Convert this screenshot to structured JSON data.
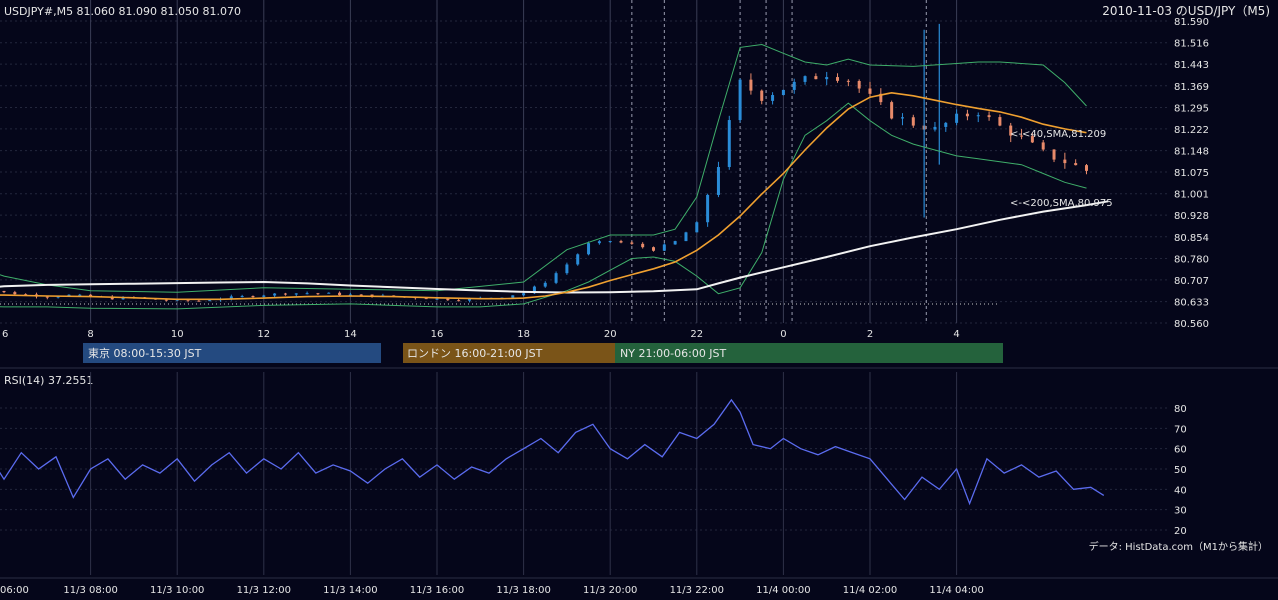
{
  "header": {
    "symbol_info": "USDJPY#,M5 81.060 81.090 81.050 81.070",
    "chart_title": "2010-11-03 のUSD/JPY（M5)"
  },
  "colors": {
    "background": "#05061a",
    "candle_up": "#2a8cd8",
    "candle_down": "#e88a6a",
    "sma40": "#f0a030",
    "sma200": "#f2f2f2",
    "bollinger": "#3fae6a",
    "rsi": "#5b6cf0",
    "tokyo_band": "#244a80",
    "london_band": "#7a5418",
    "ny_band": "#24623c"
  },
  "chart_data": [
    {
      "type": "candlestick",
      "price_ticks": [
        "81.590",
        "81.516",
        "81.443",
        "81.369",
        "81.295",
        "81.222",
        "81.148",
        "81.075",
        "81.001",
        "80.928",
        "80.854",
        "80.780",
        "80.707",
        "80.633",
        "80.560"
      ],
      "ylim": [
        80.56,
        81.59
      ],
      "hour_ticks": [
        "6",
        "8",
        "10",
        "12",
        "14",
        "16",
        "18",
        "20",
        "22",
        "0",
        "2",
        "4"
      ],
      "annotations": [
        {
          "text": "<-<40,SMA,81.209",
          "series": "sma40",
          "value": 81.209
        },
        {
          "text": "<-<200,SMA,80.975",
          "series": "sma200",
          "value": 80.975
        }
      ],
      "sessions": [
        {
          "label": "東京 08:00-15:30 JST",
          "color_key": "tokyo_band"
        },
        {
          "label": "ロンドン 16:00-21:00 JST",
          "color_key": "london_band"
        },
        {
          "label": "NY 21:00-06:00 JST",
          "color_key": "ny_band"
        }
      ],
      "close_series": [
        [
          5.0,
          80.686
        ],
        [
          5.5,
          80.676
        ],
        [
          6.0,
          80.664
        ],
        [
          6.5,
          80.657
        ],
        [
          7.0,
          80.65
        ],
        [
          7.5,
          80.655
        ],
        [
          8.0,
          80.65
        ],
        [
          8.5,
          80.644
        ],
        [
          9.0,
          80.647
        ],
        [
          9.5,
          80.64
        ],
        [
          10.0,
          80.636
        ],
        [
          10.5,
          80.636
        ],
        [
          11.0,
          80.644
        ],
        [
          11.5,
          80.65
        ],
        [
          12.0,
          80.656
        ],
        [
          12.5,
          80.661
        ],
        [
          13.0,
          80.662
        ],
        [
          13.5,
          80.66
        ],
        [
          14.0,
          80.656
        ],
        [
          14.5,
          80.653
        ],
        [
          15.0,
          80.65
        ],
        [
          15.5,
          80.647
        ],
        [
          16.0,
          80.642
        ],
        [
          16.5,
          80.64
        ],
        [
          17.0,
          80.644
        ],
        [
          17.5,
          80.65
        ],
        [
          18.0,
          80.662
        ],
        [
          18.5,
          80.7
        ],
        [
          19.0,
          80.76
        ],
        [
          19.5,
          80.83
        ],
        [
          20.0,
          80.84
        ],
        [
          20.5,
          80.828
        ],
        [
          21.0,
          80.81
        ],
        [
          21.5,
          80.838
        ],
        [
          22.0,
          80.9
        ],
        [
          22.5,
          81.1
        ],
        [
          23.0,
          81.38
        ],
        [
          23.5,
          81.33
        ],
        [
          24.0,
          81.36
        ],
        [
          24.5,
          81.39
        ],
        [
          25.0,
          81.41
        ],
        [
          25.5,
          81.39
        ],
        [
          26.0,
          81.33
        ],
        [
          26.5,
          81.27
        ],
        [
          27.0,
          81.24
        ],
        [
          27.5,
          81.22
        ],
        [
          28.0,
          81.26
        ],
        [
          28.5,
          81.28
        ],
        [
          29.0,
          81.23
        ],
        [
          29.5,
          81.19
        ],
        [
          30.0,
          81.14
        ],
        [
          30.5,
          81.11
        ],
        [
          31.0,
          81.08
        ]
      ],
      "sma40": [
        [
          5.0,
          80.655
        ],
        [
          6.0,
          80.655
        ],
        [
          7.0,
          80.652
        ],
        [
          8.0,
          80.65
        ],
        [
          9.0,
          80.646
        ],
        [
          10.0,
          80.641
        ],
        [
          11.0,
          80.641
        ],
        [
          12.0,
          80.645
        ],
        [
          13.0,
          80.65
        ],
        [
          14.0,
          80.652
        ],
        [
          15.0,
          80.65
        ],
        [
          16.0,
          80.646
        ],
        [
          17.0,
          80.643
        ],
        [
          17.5,
          80.643
        ],
        [
          18.0,
          80.645
        ],
        [
          18.5,
          80.652
        ],
        [
          19.0,
          80.665
        ],
        [
          19.5,
          80.682
        ],
        [
          20.0,
          80.705
        ],
        [
          20.5,
          80.725
        ],
        [
          21.0,
          80.745
        ],
        [
          21.5,
          80.768
        ],
        [
          22.0,
          80.808
        ],
        [
          22.5,
          80.86
        ],
        [
          23.0,
          80.925
        ],
        [
          23.5,
          81.0
        ],
        [
          24.0,
          81.07
        ],
        [
          24.5,
          81.15
        ],
        [
          25.0,
          81.225
        ],
        [
          25.5,
          81.29
        ],
        [
          26.0,
          81.33
        ],
        [
          26.5,
          81.345
        ],
        [
          27.0,
          81.335
        ],
        [
          27.5,
          81.32
        ],
        [
          28.0,
          81.305
        ],
        [
          28.5,
          81.292
        ],
        [
          29.0,
          81.28
        ],
        [
          29.5,
          81.262
        ],
        [
          30.0,
          81.238
        ],
        [
          30.5,
          81.222
        ],
        [
          31.0,
          81.209
        ]
      ],
      "sma200": [
        [
          5.0,
          80.675
        ],
        [
          6.0,
          80.685
        ],
        [
          7.0,
          80.69
        ],
        [
          8.0,
          80.692
        ],
        [
          9.0,
          80.694
        ],
        [
          10.0,
          80.696
        ],
        [
          11.0,
          80.698
        ],
        [
          12.0,
          80.7
        ],
        [
          13.0,
          80.695
        ],
        [
          14.0,
          80.688
        ],
        [
          15.0,
          80.682
        ],
        [
          16.0,
          80.676
        ],
        [
          17.0,
          80.671
        ],
        [
          18.0,
          80.666
        ],
        [
          19.0,
          80.664
        ],
        [
          20.0,
          80.665
        ],
        [
          21.0,
          80.668
        ],
        [
          22.0,
          80.675
        ],
        [
          22.5,
          80.695
        ],
        [
          23.0,
          80.715
        ],
        [
          24.0,
          80.75
        ],
        [
          25.0,
          80.785
        ],
        [
          26.0,
          80.822
        ],
        [
          27.0,
          80.852
        ],
        [
          28.0,
          80.88
        ],
        [
          29.0,
          80.912
        ],
        [
          30.0,
          80.94
        ],
        [
          31.0,
          80.962
        ],
        [
          31.5,
          80.975
        ]
      ],
      "bollinger_upper": [
        [
          5.0,
          80.77
        ],
        [
          6.0,
          80.72
        ],
        [
          7.0,
          80.69
        ],
        [
          8.0,
          80.67
        ],
        [
          10.0,
          80.665
        ],
        [
          12.0,
          80.68
        ],
        [
          14.0,
          80.675
        ],
        [
          16.0,
          80.67
        ],
        [
          18.0,
          80.7
        ],
        [
          19.0,
          80.81
        ],
        [
          20.0,
          80.86
        ],
        [
          21.0,
          80.86
        ],
        [
          21.5,
          80.88
        ],
        [
          22.0,
          80.99
        ],
        [
          22.5,
          81.25
        ],
        [
          23.0,
          81.5
        ],
        [
          23.5,
          81.51
        ],
        [
          24.0,
          81.48
        ],
        [
          24.5,
          81.45
        ],
        [
          25.0,
          81.44
        ],
        [
          25.5,
          81.46
        ],
        [
          26.0,
          81.44
        ],
        [
          27.0,
          81.435
        ],
        [
          28.0,
          81.445
        ],
        [
          28.5,
          81.45
        ],
        [
          29.0,
          81.45
        ],
        [
          30.0,
          81.44
        ],
        [
          30.5,
          81.38
        ],
        [
          31.0,
          81.3
        ]
      ],
      "bollinger_lower": [
        [
          5.0,
          80.62
        ],
        [
          6.0,
          80.615
        ],
        [
          7.0,
          80.615
        ],
        [
          8.0,
          80.61
        ],
        [
          10.0,
          80.608
        ],
        [
          12.0,
          80.62
        ],
        [
          14.0,
          80.625
        ],
        [
          16.0,
          80.615
        ],
        [
          17.0,
          80.615
        ],
        [
          18.0,
          80.625
        ],
        [
          19.0,
          80.67
        ],
        [
          19.5,
          80.7
        ],
        [
          20.0,
          80.74
        ],
        [
          20.5,
          80.78
        ],
        [
          21.0,
          80.785
        ],
        [
          21.5,
          80.77
        ],
        [
          22.0,
          80.72
        ],
        [
          22.5,
          80.66
        ],
        [
          23.0,
          80.68
        ],
        [
          23.5,
          80.8
        ],
        [
          24.0,
          81.05
        ],
        [
          24.5,
          81.2
        ],
        [
          25.0,
          81.25
        ],
        [
          25.5,
          81.31
        ],
        [
          26.0,
          81.25
        ],
        [
          26.5,
          81.2
        ],
        [
          27.0,
          81.17
        ],
        [
          27.5,
          81.15
        ],
        [
          28.0,
          81.13
        ],
        [
          28.5,
          81.12
        ],
        [
          29.0,
          81.11
        ],
        [
          29.5,
          81.1
        ],
        [
          30.0,
          81.07
        ],
        [
          30.5,
          81.04
        ],
        [
          31.0,
          81.02
        ]
      ]
    },
    {
      "type": "line",
      "title": "RSI(14) 37.2551",
      "y_ticks": [
        "80",
        "70",
        "60",
        "50",
        "40",
        "30",
        "20"
      ],
      "ylim": [
        15,
        90
      ],
      "x_ticks": [
        "06:00",
        "11/3 08:00",
        "11/3 10:00",
        "11/3 12:00",
        "11/3 14:00",
        "11/3 16:00",
        "11/3 18:00",
        "11/3 20:00",
        "11/3 22:00",
        "11/4 00:00",
        "11/4 02:00",
        "11/4 04:00"
      ],
      "values": [
        [
          5.0,
          46
        ],
        [
          5.3,
          40
        ],
        [
          5.7,
          55
        ],
        [
          6.0,
          45
        ],
        [
          6.4,
          58
        ],
        [
          6.8,
          50
        ],
        [
          7.2,
          56
        ],
        [
          7.6,
          36
        ],
        [
          8.0,
          50
        ],
        [
          8.4,
          55
        ],
        [
          8.8,
          45
        ],
        [
          9.2,
          52
        ],
        [
          9.6,
          48
        ],
        [
          10.0,
          55
        ],
        [
          10.4,
          44
        ],
        [
          10.8,
          52
        ],
        [
          11.2,
          58
        ],
        [
          11.6,
          48
        ],
        [
          12.0,
          55
        ],
        [
          12.4,
          50
        ],
        [
          12.8,
          58
        ],
        [
          13.2,
          48
        ],
        [
          13.6,
          52
        ],
        [
          14.0,
          49
        ],
        [
          14.4,
          43
        ],
        [
          14.8,
          50
        ],
        [
          15.2,
          55
        ],
        [
          15.6,
          46
        ],
        [
          16.0,
          52
        ],
        [
          16.4,
          45
        ],
        [
          16.8,
          51
        ],
        [
          17.2,
          48
        ],
        [
          17.6,
          55
        ],
        [
          18.0,
          60
        ],
        [
          18.4,
          65
        ],
        [
          18.8,
          58
        ],
        [
          19.2,
          68
        ],
        [
          19.6,
          72
        ],
        [
          20.0,
          60
        ],
        [
          20.4,
          55
        ],
        [
          20.8,
          62
        ],
        [
          21.2,
          56
        ],
        [
          21.6,
          68
        ],
        [
          22.0,
          65
        ],
        [
          22.4,
          72
        ],
        [
          22.8,
          84
        ],
        [
          23.0,
          78
        ],
        [
          23.3,
          62
        ],
        [
          23.7,
          60
        ],
        [
          24.0,
          65
        ],
        [
          24.4,
          60
        ],
        [
          24.8,
          57
        ],
        [
          25.2,
          61
        ],
        [
          25.6,
          58
        ],
        [
          26.0,
          55
        ],
        [
          26.4,
          45
        ],
        [
          26.8,
          35
        ],
        [
          27.2,
          46
        ],
        [
          27.6,
          40
        ],
        [
          28.0,
          50
        ],
        [
          28.3,
          33
        ],
        [
          28.7,
          55
        ],
        [
          29.1,
          48
        ],
        [
          29.5,
          52
        ],
        [
          29.9,
          46
        ],
        [
          30.3,
          49
        ],
        [
          30.7,
          40
        ],
        [
          31.1,
          41
        ],
        [
          31.4,
          37
        ]
      ]
    }
  ],
  "footer": {
    "data_source": "データ: HistData.com（M1から集計）"
  }
}
